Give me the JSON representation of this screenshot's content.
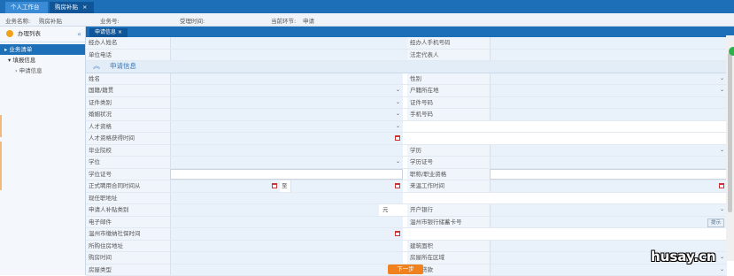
{
  "top_tabs": [
    {
      "label": "个人工作台"
    },
    {
      "label": "购房补贴",
      "close": "×"
    }
  ],
  "info_bar": {
    "biz_name_label": "业务名称:",
    "biz_name_value": "购房补贴",
    "biz_no_label": "业务号:",
    "accept_time_label": "受理时间:",
    "current_step_label": "当前环节:",
    "current_step_value": "申请"
  },
  "sidebar": {
    "header": "办理列表",
    "collapse": "«",
    "active_item": "▸ 业务清单",
    "items": [
      {
        "label": "▾ 填报信息"
      },
      {
        "label": "› 申请信息"
      }
    ]
  },
  "inner_tab": {
    "label": "申请信息",
    "close": "×"
  },
  "top_rows": [
    {
      "left_label": "经办人姓名",
      "right_label": "经办人手机号码"
    },
    {
      "left_label": "单位电话",
      "right_label": "法定代表人"
    }
  ],
  "section": {
    "title": "申请信息",
    "chevron": "︽"
  },
  "form_rows": [
    {
      "left_label": "姓名",
      "right_label": "性别",
      "right_dd": "⌄"
    },
    {
      "left_label": "国籍/籍贯",
      "left_dd": "⌄",
      "right_label": "户籍所在地",
      "right_dd": "⌄"
    },
    {
      "left_label": "证件类别",
      "left_dd": "⌄",
      "right_label": "证件号码"
    },
    {
      "left_label": "婚姻状况",
      "left_dd": "⌄",
      "right_label": "手机号码"
    },
    {
      "left_label": "人才资格",
      "left_dd": "⌄"
    },
    {
      "left_label": "人才资格获得时间"
    },
    {
      "left_label": "毕业院校",
      "right_label": "学历",
      "right_dd": "⌄"
    },
    {
      "left_label": "学位",
      "left_dd": "⌄",
      "right_label": "学历证号"
    },
    {
      "left_label": "学位证号",
      "right_label": "职称/职业资格"
    },
    {
      "left_label": "正式聘用合同时间从",
      "to_label": "至",
      "right_label": "来温工作时间"
    },
    {
      "left_label": "现任职地址"
    },
    {
      "left_label": "申请人补贴类别",
      "suffix": "元",
      "right_label": "开户银行",
      "right_dd": "⌄"
    },
    {
      "left_label": "电子邮件",
      "right_label": "温州市银行储蓄卡号",
      "hint_button": "提示"
    },
    {
      "left_label": "温州市缴纳社保时间"
    },
    {
      "left_label": "所购住房地址",
      "right_label": "建筑面积"
    },
    {
      "left_label": "购房时间",
      "right_label": "房屋所在区域",
      "right_dd": "⌄"
    },
    {
      "left_label": "房屋类型",
      "left_dd": "⌄",
      "right_label": "是否贷款",
      "right_dd": "⌄"
    }
  ],
  "next_button": "下一步",
  "watermark": "husay.cn"
}
